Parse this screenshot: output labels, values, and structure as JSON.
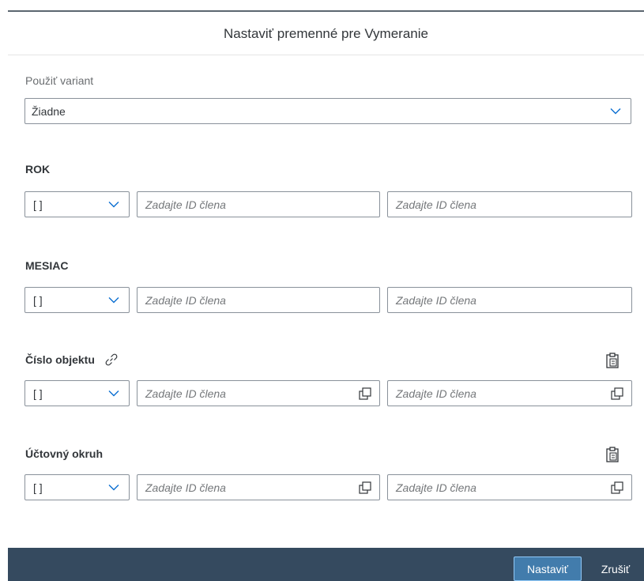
{
  "dialog": {
    "title": "Nastaviť premenné pre Vymeranie"
  },
  "variant": {
    "label": "Použiť variant",
    "value": "Žiadne"
  },
  "sections": [
    {
      "label": "ROK",
      "operator": "[ ]",
      "from_placeholder": "Zadajte ID člena",
      "to_placeholder": "Zadajte ID člena"
    },
    {
      "label": "MESIAC",
      "operator": "[ ]",
      "from_placeholder": "Zadajte ID člena",
      "to_placeholder": "Zadajte ID člena"
    },
    {
      "label": "Číslo objektu",
      "operator": "[ ]",
      "from_placeholder": "Zadajte ID člena",
      "to_placeholder": "Zadajte ID člena"
    },
    {
      "label": "Účtovný okruh",
      "operator": "[ ]",
      "from_placeholder": "Zadajte ID člena",
      "to_placeholder": "Zadajte ID člena"
    }
  ],
  "footer": {
    "set_label": "Nastaviť",
    "cancel_label": "Zrušiť"
  }
}
